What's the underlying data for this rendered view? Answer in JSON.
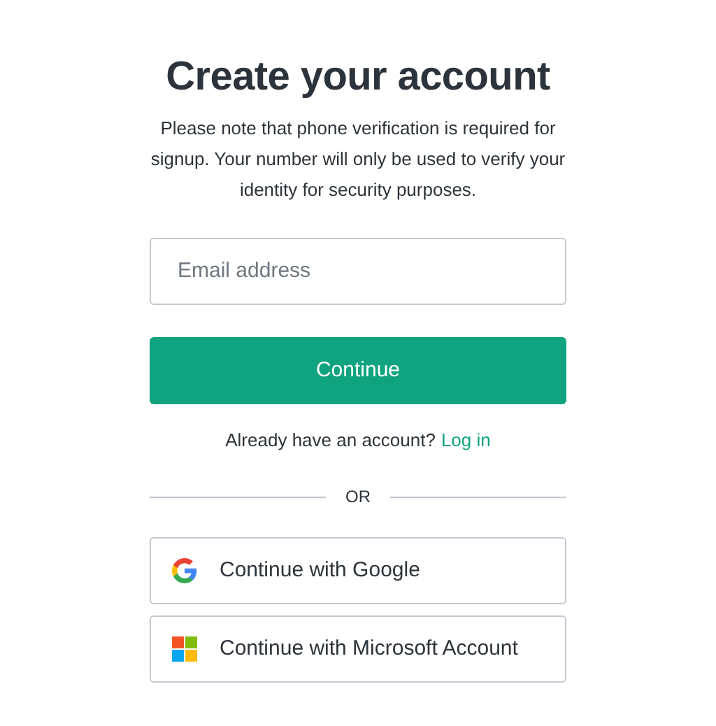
{
  "title": "Create your account",
  "description": "Please note that phone verification is required for signup. Your number will only be used to verify your identity for security purposes.",
  "email_field": {
    "placeholder": "Email address"
  },
  "continue_button": "Continue",
  "login_prompt": {
    "text": "Already have an account?",
    "link": "Log in"
  },
  "divider_text": "OR",
  "social_buttons": [
    {
      "kind": "google",
      "label": "Continue with Google"
    },
    {
      "kind": "microsoft",
      "label": "Continue with Microsoft Account"
    }
  ]
}
